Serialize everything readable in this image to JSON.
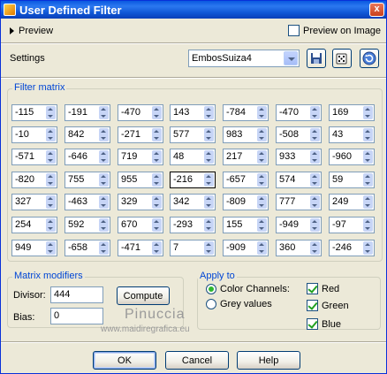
{
  "window": {
    "title": "User Defined Filter",
    "close_glyph": "x"
  },
  "preview": {
    "toggle_label": "Preview",
    "on_image_label": "Preview on Image",
    "on_image_checked": false
  },
  "settings": {
    "label": "Settings",
    "selected": "EmbosSuiza4",
    "icons": [
      "save-icon",
      "randomize-dice-icon",
      "reset-icon"
    ]
  },
  "matrix": {
    "label": "Filter matrix",
    "rows": [
      [
        "-115",
        "-191",
        "-470",
        "143",
        "-784",
        "-470",
        "169"
      ],
      [
        "-10",
        "842",
        "-271",
        "577",
        "983",
        "-508",
        "43"
      ],
      [
        "-571",
        "-646",
        "719",
        "48",
        "217",
        "933",
        "-960"
      ],
      [
        "-820",
        "755",
        "955",
        "-216",
        "-657",
        "574",
        "59"
      ],
      [
        "327",
        "-463",
        "329",
        "342",
        "-809",
        "777",
        "249"
      ],
      [
        "254",
        "592",
        "670",
        "-293",
        "155",
        "-949",
        "-97"
      ],
      [
        "949",
        "-658",
        "-471",
        "7",
        "-909",
        "360",
        "-246"
      ]
    ]
  },
  "modifiers": {
    "label": "Matrix modifiers",
    "divisor_label": "Divisor:",
    "divisor": "444",
    "bias_label": "Bias:",
    "bias": "0",
    "compute_label": "Compute"
  },
  "apply_to": {
    "label": "Apply to",
    "color_channels": "Color Channels:",
    "grey_values": "Grey values",
    "mode": "color_channels",
    "red": "Red",
    "green": "Green",
    "blue": "Blue",
    "red_checked": true,
    "green_checked": true,
    "blue_checked": true
  },
  "watermark": {
    "name": "Pinuccia",
    "site": "www.maidiregrafica.eu"
  },
  "buttons": {
    "ok": "OK",
    "cancel": "Cancel",
    "help": "Help"
  }
}
